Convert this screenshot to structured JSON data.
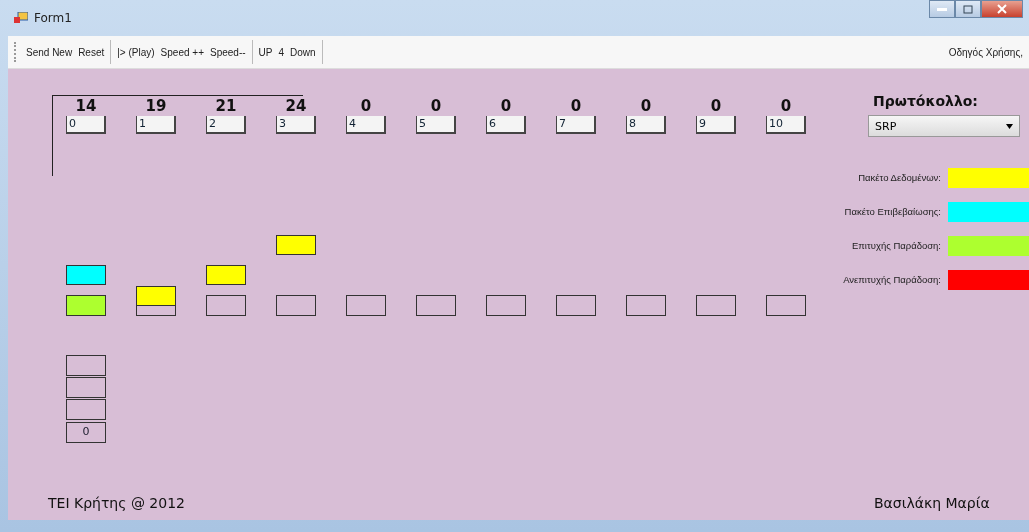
{
  "window": {
    "title": "Form1"
  },
  "toolbar": {
    "groups": [
      [
        "Send New",
        "Reset"
      ],
      [
        "|> (Play)",
        "Speed ++",
        "Speed--"
      ],
      [
        "UP",
        "4",
        "Down"
      ]
    ],
    "help": "Οδηγός Χρήσης,"
  },
  "slots": [
    {
      "counter": "14",
      "label": "0",
      "delivered": true,
      "packet": {
        "kind": "ack"
      }
    },
    {
      "counter": "19",
      "label": "1",
      "delivered": false,
      "packet": {
        "kind": "data"
      }
    },
    {
      "counter": "21",
      "label": "2",
      "delivered": false,
      "packet": {
        "kind": "data"
      }
    },
    {
      "counter": "24",
      "label": "3",
      "delivered": false,
      "packet": {
        "kind": "data"
      }
    },
    {
      "counter": "0",
      "label": "4",
      "delivered": false
    },
    {
      "counter": "0",
      "label": "5",
      "delivered": false
    },
    {
      "counter": "0",
      "label": "6",
      "delivered": false
    },
    {
      "counter": "0",
      "label": "7",
      "delivered": false
    },
    {
      "counter": "0",
      "label": "8",
      "delivered": false
    },
    {
      "counter": "0",
      "label": "9",
      "delivered": false
    },
    {
      "counter": "0",
      "label": "10",
      "delivered": false
    }
  ],
  "buffer": {
    "count": "0"
  },
  "protocol": {
    "label": "Πρωτόκολλο:",
    "value": "SRP"
  },
  "legend": [
    {
      "label": "Πακέτο Δεδομένων:",
      "color": "#ffff00"
    },
    {
      "label": "Πακέτο Επιβεβαίωσης:",
      "color": "#00ffff"
    },
    {
      "label": "Επιτυχής Παράδοση:",
      "color": "#adff2f"
    },
    {
      "label": "Ανεπιτυχής Παράδοση:",
      "color": "#ff0000"
    }
  ],
  "footer": {
    "left": "TEI Κρήτης @ 2012",
    "right": "Βασιλάκη Μαρία"
  }
}
